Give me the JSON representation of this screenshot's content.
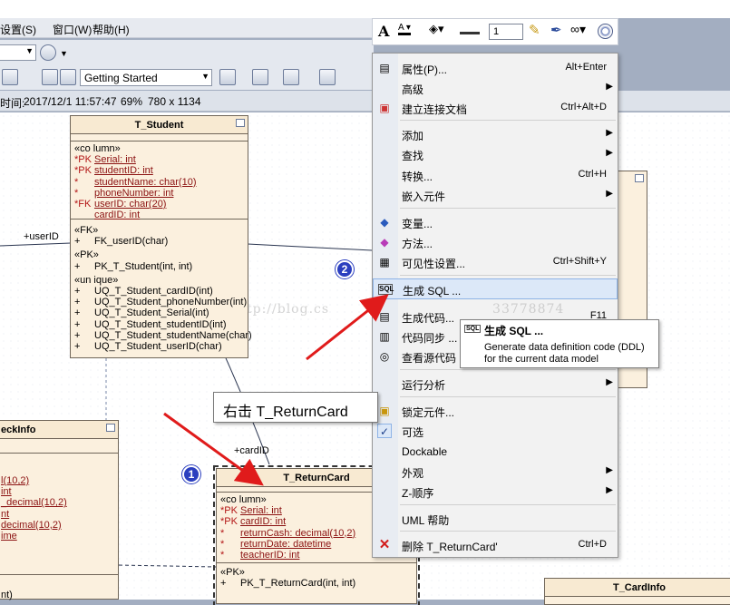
{
  "menubar": {
    "settings": "设置(S)",
    "window": "窗口(W)",
    "help": "帮助(H)"
  },
  "toolbar": {
    "start_combo": "Getting Started"
  },
  "infobar": {
    "time_label": "时间:",
    "time": "2017/12/1 11:57:47",
    "zoom": "69%",
    "size": "780 x 1134"
  },
  "format_toolbar": {
    "line_width": "1"
  },
  "entities": {
    "student": {
      "title": "T_Student",
      "stereo_column": "«co lumn»",
      "columns": [
        {
          "mark": "*PK",
          "text": "Serial:  int"
        },
        {
          "mark": "*PK",
          "text": "studentID:  int"
        },
        {
          "mark": "*",
          "text": "studentName:  char(10)"
        },
        {
          "mark": "*",
          "text": "phoneNumber:  int"
        },
        {
          "mark": "*FK",
          "text": "userID:  char(20)"
        },
        {
          "mark": "",
          "text": "cardID:  int"
        }
      ],
      "stereo_fk": "«FK»",
      "fk_ops": [
        {
          "op": "+",
          "text": "FK_userID(char)"
        }
      ],
      "stereo_pk": "«PK»",
      "pk_ops": [
        {
          "op": "+",
          "text": "PK_T_Student(int, int)"
        }
      ],
      "stereo_unique": "«un ique»",
      "unique_ops": [
        {
          "op": "+",
          "text": "UQ_T_Student_cardID(int)"
        },
        {
          "op": "+",
          "text": "UQ_T_Student_phoneNumber(int)"
        },
        {
          "op": "+",
          "text": "UQ_T_Student_Serial(int)"
        },
        {
          "op": "+",
          "text": "UQ_T_Student_studentID(int)"
        },
        {
          "op": "+",
          "text": "UQ_T_Student_studentName(char)"
        },
        {
          "op": "+",
          "text": "UQ_T_Student_userID(char)"
        }
      ]
    },
    "checkinfo": {
      "title": "eckInfo",
      "columns": [
        "l(10,2)",
        "int",
        "_decimal(10,2)",
        "nt",
        "decimal(10,2)",
        "ime"
      ],
      "op": "nt)"
    },
    "returncard": {
      "title": "T_ReturnCard",
      "stereo_column": "«co lumn»",
      "columns": [
        {
          "mark": "*PK",
          "text": "Serial:  int"
        },
        {
          "mark": "*PK",
          "text": "cardID:  int"
        },
        {
          "mark": "*",
          "text": "returnCash:  decimal(10,2)"
        },
        {
          "mark": "*",
          "text": "returnDate:  datetime"
        },
        {
          "mark": "*",
          "text": "teacherID:  int"
        }
      ],
      "stereo_pk": "«PK»",
      "pk_ops": [
        {
          "op": "+",
          "text": "PK_T_ReturnCard(int, int)"
        }
      ]
    },
    "cardinfo": {
      "title": "T_CardInfo"
    }
  },
  "connectors": {
    "userid": "+userID",
    "cardid": "+cardID"
  },
  "context_menu": {
    "items": [
      {
        "label": "属性(P)...",
        "shortcut": "Alt+Enter",
        "icon": "properties-icon"
      },
      {
        "label": "高级",
        "submenu": true
      },
      {
        "label": "建立连接文档",
        "shortcut": "Ctrl+Alt+D",
        "icon": "link-doc-icon"
      },
      {
        "label": "添加",
        "submenu": true
      },
      {
        "label": "查找",
        "submenu": true
      },
      {
        "label": "转换...",
        "shortcut": "Ctrl+H"
      },
      {
        "label": "嵌入元件",
        "submenu": true
      },
      {
        "label": "变量...",
        "icon": "variable-icon"
      },
      {
        "label": "方法...",
        "icon": "method-icon"
      },
      {
        "label": "可见性设置...",
        "shortcut": "Ctrl+Shift+Y",
        "icon": "visibility-icon"
      },
      {
        "label": "生成 SQL ...",
        "icon": "sql-icon"
      },
      {
        "label": "生成代码...",
        "shortcut": "F11",
        "icon": "generate-code-icon"
      },
      {
        "label": "代码同步 ...",
        "icon": "sync-code-icon"
      },
      {
        "label": "查看源代码",
        "icon": "view-source-icon"
      },
      {
        "label": "运行分析",
        "submenu": true
      },
      {
        "label": "锁定元件...",
        "icon": "lock-icon"
      },
      {
        "label": "可选",
        "icon": "check-icon"
      },
      {
        "label": "Dockable"
      },
      {
        "label": "外观",
        "submenu": true
      },
      {
        "label": "Z-顺序",
        "submenu": true
      },
      {
        "label": "UML 帮助"
      },
      {
        "label": "删除 T_ReturnCard'",
        "shortcut": "Ctrl+D",
        "icon": "delete-icon"
      }
    ]
  },
  "tooltip": {
    "title": "生成 SQL ...",
    "line1": "Generate data definition code (DDL)",
    "line2": "for the current data model"
  },
  "callout": {
    "text": "右击 T_ReturnCard"
  },
  "badges": {
    "one": "1",
    "two": "2"
  },
  "watermark": "tp://blog.cs",
  "watermark2": "33778874"
}
